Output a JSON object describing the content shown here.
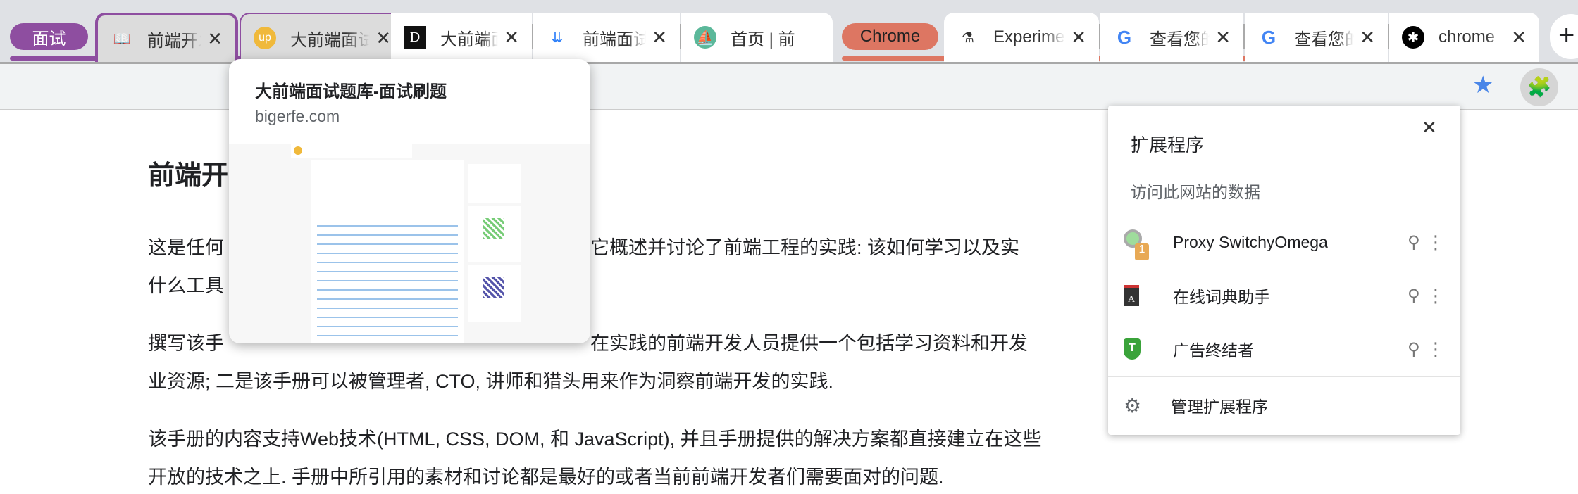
{
  "tabs": {
    "groups": [
      {
        "label": "面试",
        "color": "#8e4ea0"
      },
      {
        "label": "Chrome",
        "color": "#dd7662"
      }
    ],
    "items": [
      {
        "title": "前端开发",
        "icon": "book-icon"
      },
      {
        "title": "大前端面试题库-面试刷题",
        "icon": "up-logo-icon"
      },
      {
        "title": "大前端面",
        "icon": "d-logo-icon"
      },
      {
        "title": "前端面试",
        "icon": "download-arrows-icon"
      },
      {
        "title": "首页 | 前",
        "icon": "sailboat-icon"
      },
      {
        "title": "Experiments",
        "icon": "flask-icon"
      },
      {
        "title": "查看您的",
        "icon": "google-icon"
      },
      {
        "title": "查看您的",
        "icon": "google-icon"
      },
      {
        "title": "chrome",
        "icon": "bug-icon"
      }
    ],
    "close": "✕",
    "new_tab": "+"
  },
  "hover_card": {
    "title": "大前端面试题库-面试刷题",
    "domain": "bigerfe.com"
  },
  "page": {
    "heading": "前端开",
    "lines": [
      "这是任何",
      "它概述并讨论了前端工程的实践: 该如何学习以及实",
      "什么工具",
      "撰写该手",
      "在实践的前端开发人员提供一个包括学习资料和开发",
      "业资源; 二是该手册可以被管理者, CTO, 讲师和猎头用来作为洞察前端开发的实践.",
      "该手册的内容支持Web技术(HTML, CSS, DOM, 和 JavaScript), 并且手册提供的解决方案都直接建立在这些",
      "开放的技术之上. 手册中所引用的素材和讨论都是最好的或者当前前端开发者们需要面对的问题."
    ]
  },
  "extensions": {
    "title": "扩展程序",
    "close": "✕",
    "section": "访问此网站的数据",
    "items": [
      {
        "name": "Proxy SwitchyOmega",
        "badge": "1"
      },
      {
        "name": "在线词典助手"
      },
      {
        "name": "广告终结者"
      }
    ],
    "manage": "管理扩展程序"
  }
}
